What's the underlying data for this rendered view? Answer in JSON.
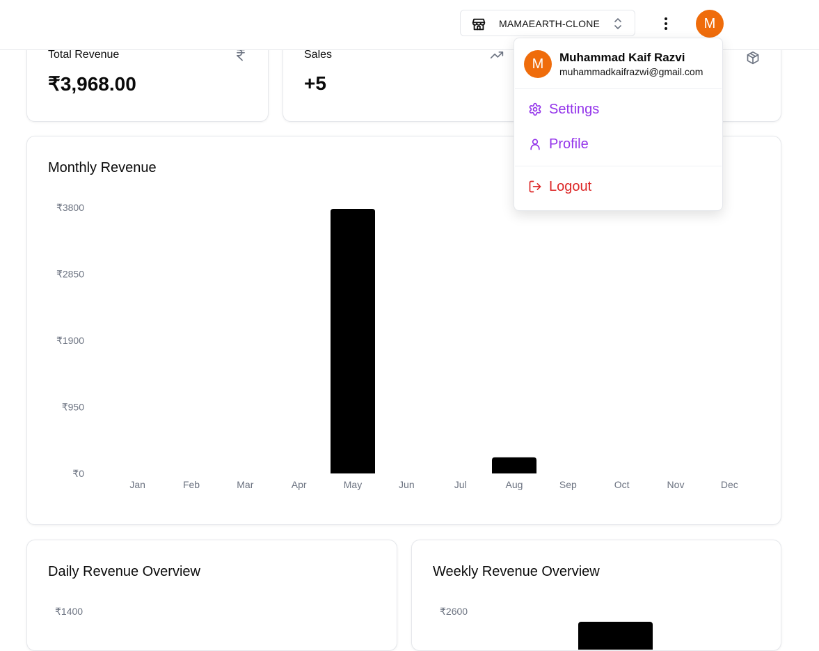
{
  "header": {
    "store_name": "MAMAEARTH-CLONE",
    "user_initial": "M"
  },
  "stats": [
    {
      "label": "Total Revenue",
      "value": "₹3,968.00",
      "icon": "rupee-icon"
    },
    {
      "label": "Sales",
      "value": "+5",
      "icon": "trending-up-icon"
    },
    {
      "icon": "package-icon"
    }
  ],
  "user_menu": {
    "initial": "M",
    "name": "Muhammad Kaif Razvi",
    "email": "muhammadkaifrazwi@gmail.com",
    "items": [
      {
        "label": "Settings",
        "icon": "gear-icon",
        "color": "#9333ea"
      },
      {
        "label": "Profile",
        "icon": "user-icon",
        "color": "#9333ea"
      },
      {
        "label": "Logout",
        "icon": "logout-icon",
        "color": "#dc2626"
      }
    ]
  },
  "monthly": {
    "title": "Monthly Revenue"
  },
  "daily": {
    "title": "Daily Revenue Overview"
  },
  "weekly": {
    "title": "Weekly Revenue Overview"
  },
  "chart_data": [
    {
      "type": "bar",
      "title": "Monthly Revenue",
      "categories": [
        "Jan",
        "Feb",
        "Mar",
        "Apr",
        "May",
        "Jun",
        "Jul",
        "Aug",
        "Sep",
        "Oct",
        "Nov",
        "Dec"
      ],
      "values": [
        0,
        0,
        0,
        0,
        3780,
        0,
        0,
        230,
        0,
        0,
        0,
        0
      ],
      "yticks": [
        0,
        950,
        1900,
        2850,
        3800
      ],
      "ytick_labels": [
        "₹0",
        "₹950",
        "₹1900",
        "₹2850",
        "₹3800"
      ],
      "ylim": [
        0,
        3800
      ],
      "grid": false,
      "bar_color": "#000000"
    },
    {
      "type": "bar",
      "title": "Daily Revenue Overview",
      "ytick_labels": [
        "₹1400"
      ]
    },
    {
      "type": "bar",
      "title": "Weekly Revenue Overview",
      "ytick_labels": [
        "₹2600"
      ]
    }
  ]
}
